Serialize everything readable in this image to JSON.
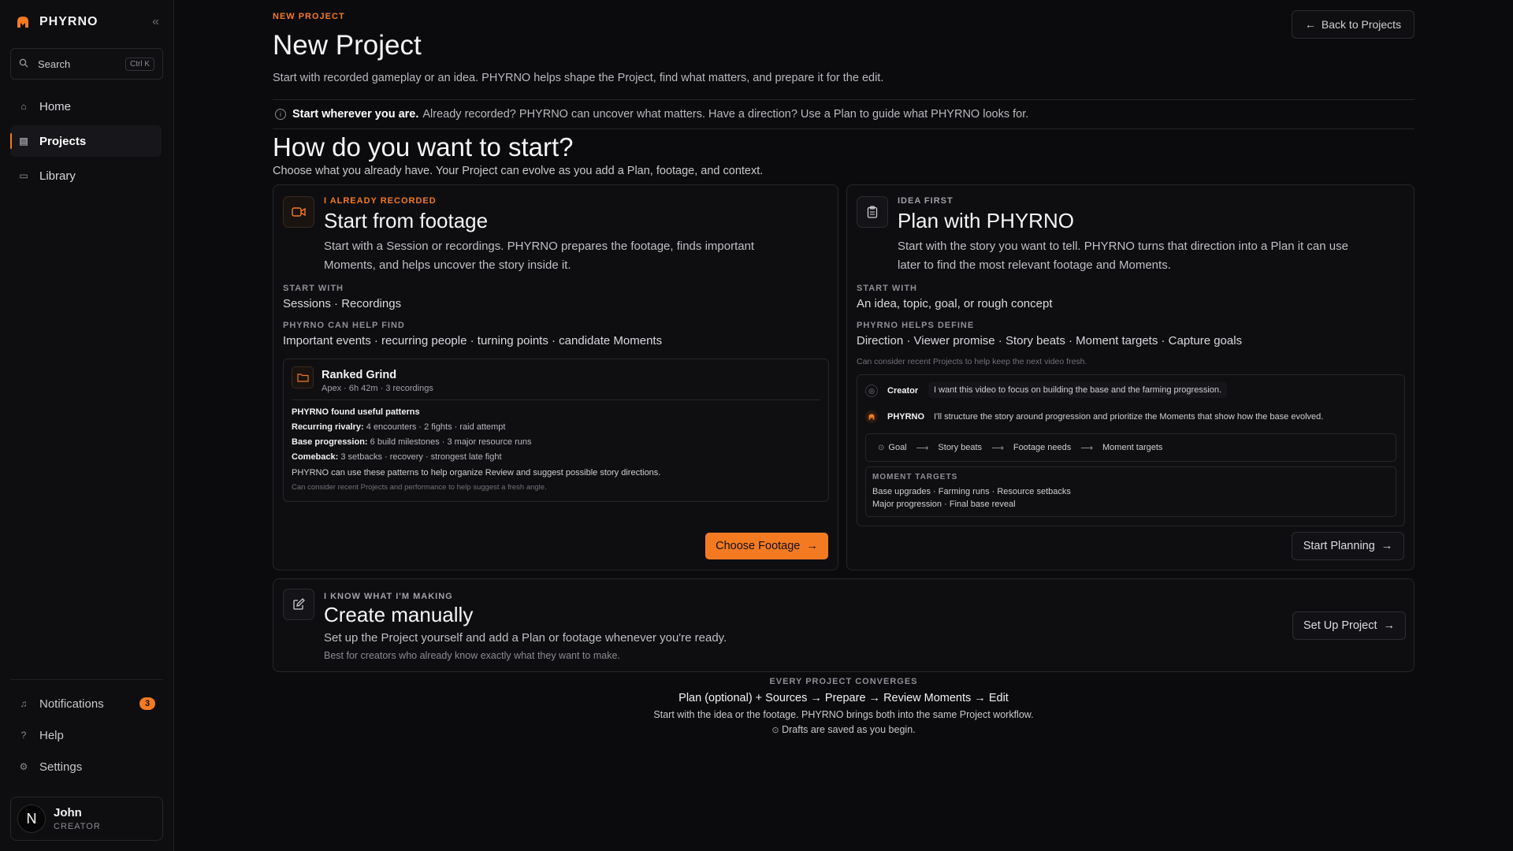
{
  "sidebar": {
    "brand": "PHYRNO",
    "search": {
      "label": "Search",
      "shortcut": "Ctrl K"
    },
    "nav": [
      {
        "label": "Home",
        "icon": "home-icon"
      },
      {
        "label": "Projects",
        "icon": "projects-icon",
        "active": true
      },
      {
        "label": "Library",
        "icon": "library-icon"
      }
    ],
    "bottom": {
      "notifications": {
        "label": "Notifications",
        "count": "3"
      },
      "help": "Help",
      "settings": "Settings"
    },
    "user": {
      "initial": "N",
      "name": "John",
      "role": "CREATOR"
    }
  },
  "header": {
    "eyebrow": "NEW PROJECT",
    "title": "New Project",
    "subtitle": "Start with recorded gameplay or an idea. PHYRNO helps shape the Project, find what matters, and prepare it for the edit.",
    "back_label": "Back to Projects"
  },
  "info": {
    "bold": "Start wherever you are.",
    "text": "Already recorded? PHYRNO can uncover what matters. Have a direction? Use a Plan to guide what PHYRNO looks for."
  },
  "section": {
    "title": "How do you want to start?",
    "subtitle": "Choose what you already have. Your Project can evolve as you add a Plan, footage, and context."
  },
  "footage_card": {
    "eyebrow": "I ALREADY RECORDED",
    "title": "Start from footage",
    "desc1": "Start with a Session or recordings. PHYRNO prepares the footage, finds important",
    "desc2": "Moments, and helps uncover the story inside it.",
    "start_with_label": "START WITH",
    "start_with": "Sessions · Recordings",
    "help_find_label": "PHYRNO CAN HELP FIND",
    "help_find": "Important events · recurring people · turning points · candidate Moments",
    "session": {
      "name": "Ranked Grind",
      "meta": "Apex · 6h 42m · 3 recordings",
      "patterns_title": "PHYRNO found useful patterns",
      "patterns": [
        {
          "key": "Recurring rivalry:",
          "value": "4 encounters · 2 fights · raid attempt"
        },
        {
          "key": "Base progression:",
          "value": "6 build milestones · 3 major resource runs"
        },
        {
          "key": "Comeback:",
          "value": "3 setbacks · recovery · strongest late fight"
        }
      ],
      "note": "PHYRNO can use these patterns to help organize Review and suggest possible story directions.",
      "hint": "Can consider recent Projects and performance to help suggest a fresh angle."
    },
    "button": "Choose Footage"
  },
  "plan_card": {
    "eyebrow": "IDEA FIRST",
    "title": "Plan with PHYRNO",
    "desc1": "Start with the story you want to tell. PHYRNO turns that direction into a Plan it can use",
    "desc2": "later to find the most relevant footage and Moments.",
    "start_with_label": "START WITH",
    "start_with": "An idea, topic, goal, or rough concept",
    "defines_label": "PHYRNO HELPS DEFINE",
    "defines": "Direction · Viewer promise · Story beats · Moment targets · Capture goals",
    "hint": "Can consider recent Projects to help keep the next video fresh.",
    "chat": [
      {
        "speaker": "Creator",
        "text": "I want this video to focus on building the base and the farming progression."
      },
      {
        "speaker": "PHYRNO",
        "text": "I'll structure the story around progression and prioritize the Moments that show how the base evolved."
      }
    ],
    "flow": [
      "Goal",
      "Story beats",
      "Footage needs",
      "Moment targets"
    ],
    "targets_label": "MOMENT TARGETS",
    "targets1": "Base upgrades · Farming runs · Resource setbacks",
    "targets2": "Major progression · Final base reveal",
    "button": "Start Planning"
  },
  "manual_card": {
    "eyebrow": "I KNOW WHAT I'M MAKING",
    "title": "Create manually",
    "desc": "Set up the Project yourself and add a Plan or footage whenever you're ready.",
    "hint": "Best for creators who already know exactly what they want to make.",
    "button": "Set Up Project"
  },
  "converge": {
    "label": "EVERY PROJECT CONVERGES",
    "flow": "Plan (optional) + Sources → Prepare → Review Moments → Edit",
    "desc": "Start with the idea or the footage. PHYRNO brings both into the same Project workflow.",
    "saved": "Drafts are saved as you begin."
  },
  "colors": {
    "accent": "#f47a22",
    "background": "#0b0b0d"
  }
}
